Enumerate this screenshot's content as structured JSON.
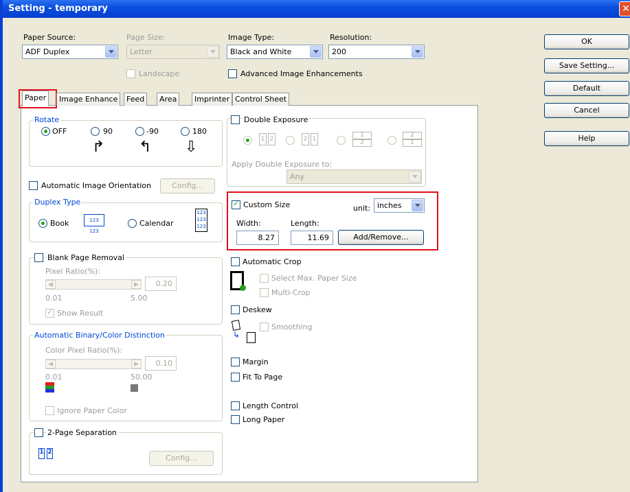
{
  "window": {
    "title": "Setting - temporary"
  },
  "top": {
    "paper_source_label": "Paper Source:",
    "paper_source_value": "ADF Duplex",
    "page_size_label": "Page Size:",
    "page_size_value": "Letter",
    "landscape_label": "Landscape",
    "image_type_label": "Image Type:",
    "image_type_value": "Black and White",
    "resolution_label": "Resolution:",
    "resolution_value": "200",
    "advanced_label": "Advanced Image Enhancements"
  },
  "buttons": {
    "ok": "OK",
    "save": "Save Setting...",
    "default": "Default",
    "cancel": "Cancel",
    "help": "Help"
  },
  "tabs": [
    "Paper",
    "Image Enhance",
    "Feed",
    "Area",
    "Imprinter",
    "Control Sheet"
  ],
  "rotate": {
    "title": "Rotate",
    "off": "OFF",
    "r90": "90",
    "rm90": "-90",
    "r180": "180"
  },
  "auto_orient": {
    "label": "Automatic Image Orientation",
    "config": "Config..."
  },
  "duplex": {
    "title": "Duplex Type",
    "book": "Book",
    "calendar": "Calendar",
    "icon_text": "123 123"
  },
  "blank": {
    "label": "Blank Page Removal",
    "ratio_label": "Pixel Ratio(%):",
    "value": "0.20",
    "min": "0.01",
    "max": "5.00",
    "show": "Show Result"
  },
  "binary": {
    "title": "Automatic Binary/Color Distinction",
    "ratio_label": "Color Pixel Ratio(%):",
    "value": "0.10",
    "min": "0.01",
    "max": "50.00",
    "ignore": "Ignore Paper Color"
  },
  "two_page": {
    "label": "2-Page Separation",
    "config": "Config...",
    "p1": "1",
    "p2": "2"
  },
  "double_exp": {
    "label": "Double Exposure",
    "apply_label": "Apply Double Exposure to:",
    "apply_value": "Any",
    "opt1": [
      "1",
      "2"
    ],
    "opt2": [
      "2",
      "1"
    ],
    "opt3": [
      "1",
      "2"
    ],
    "opt4": [
      "2",
      "1"
    ]
  },
  "custom": {
    "label": "Custom Size",
    "unit_label": "unit:",
    "unit_value": "inches",
    "width_label": "Width:",
    "length_label": "Length:",
    "width": "8.27",
    "length": "11.69",
    "add_remove": "Add/Remove..."
  },
  "auto_crop": {
    "label": "Automatic Crop",
    "select_max": "Select Max. Paper Size",
    "multi": "Multi-Crop"
  },
  "deskew": {
    "label": "Deskew",
    "smoothing": "Smoothing"
  },
  "margin": {
    "label": "Margin"
  },
  "fit": {
    "label": "Fit To Page"
  },
  "length_control": {
    "label": "Length Control"
  },
  "long_paper": {
    "label": "Long Paper"
  },
  "colors": {
    "titlebar": "#0b4fe0",
    "highlight": "#e0101a",
    "accent_green": "#21a121",
    "group_title": "#0046d5"
  }
}
